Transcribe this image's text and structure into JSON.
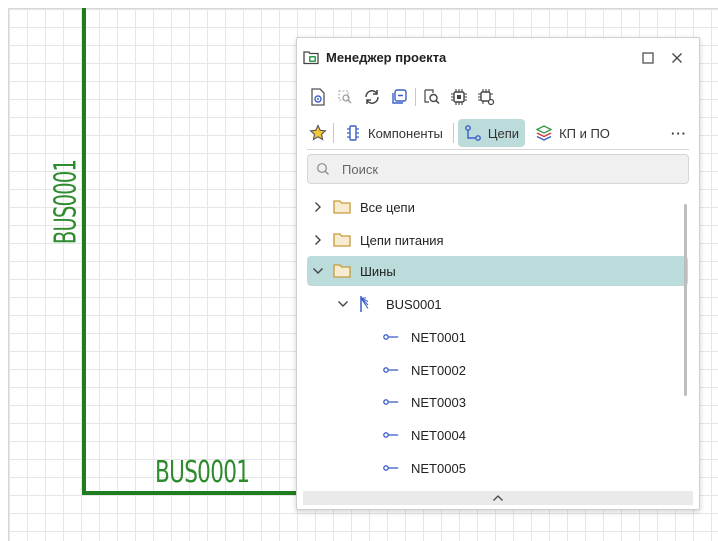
{
  "colors": {
    "wire": "#1e7d1e",
    "label": "#2e8b2e",
    "accent_selected": "#bcdcdb",
    "folder": "#c79a3a",
    "net_icon": "#3b5fc9"
  },
  "canvas": {
    "bus_label_vertical": "BUS0001",
    "bus_label_horizontal": "BUS0001"
  },
  "panel": {
    "title": "Менеджер проекта",
    "title_icon": "project-manager-icon",
    "window_buttons": [
      "maximize-icon",
      "close-icon"
    ],
    "toolbar_icons": [
      "show-icon",
      "zoom-to-icon",
      "refresh-icon",
      "collapse-all-icon",
      "find-icon",
      "chip-icon",
      "chip-settings-icon"
    ],
    "tabs": [
      {
        "label": "",
        "icon": "star-icon",
        "active": false
      },
      {
        "label": "Компоненты",
        "icon": "component-icon",
        "active": false
      },
      {
        "label": "Цепи",
        "icon": "net-icon",
        "active": true
      },
      {
        "label": "КП и ПО",
        "icon": "layers-icon",
        "active": false
      }
    ],
    "more_label": "···",
    "search": {
      "placeholder": "Поиск",
      "value": ""
    },
    "tree": [
      {
        "label": "Все цепи",
        "type": "folder",
        "expanded": false,
        "level": 0
      },
      {
        "label": "Цепи питания",
        "type": "folder",
        "expanded": false,
        "level": 0
      },
      {
        "label": "Шины",
        "type": "folder",
        "expanded": true,
        "level": 0,
        "selected": true
      },
      {
        "label": "BUS0001",
        "type": "bus",
        "expanded": true,
        "level": 1
      },
      {
        "label": "NET0001",
        "type": "net",
        "level": 2
      },
      {
        "label": "NET0002",
        "type": "net",
        "level": 2
      },
      {
        "label": "NET0003",
        "type": "net",
        "level": 2
      },
      {
        "label": "NET0004",
        "type": "net",
        "level": 2
      },
      {
        "label": "NET0005",
        "type": "net",
        "level": 2
      }
    ]
  }
}
